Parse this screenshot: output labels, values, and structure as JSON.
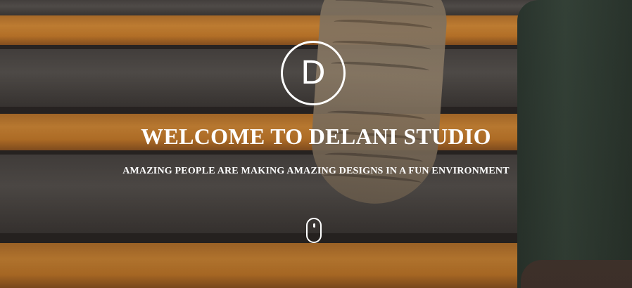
{
  "hero": {
    "logo_letter": "D",
    "title": "WELCOME TO DELANI STUDIO",
    "subtitle": "AMAZING PEOPLE ARE MAKING AMAZING DESIGNS IN A FUN ENVIRONMENT",
    "scroll_icon": "mouse-scroll-icon"
  },
  "colors": {
    "text": "#ffffff",
    "stair_edge": "#e19235",
    "stair_surface": "#5a5650"
  }
}
